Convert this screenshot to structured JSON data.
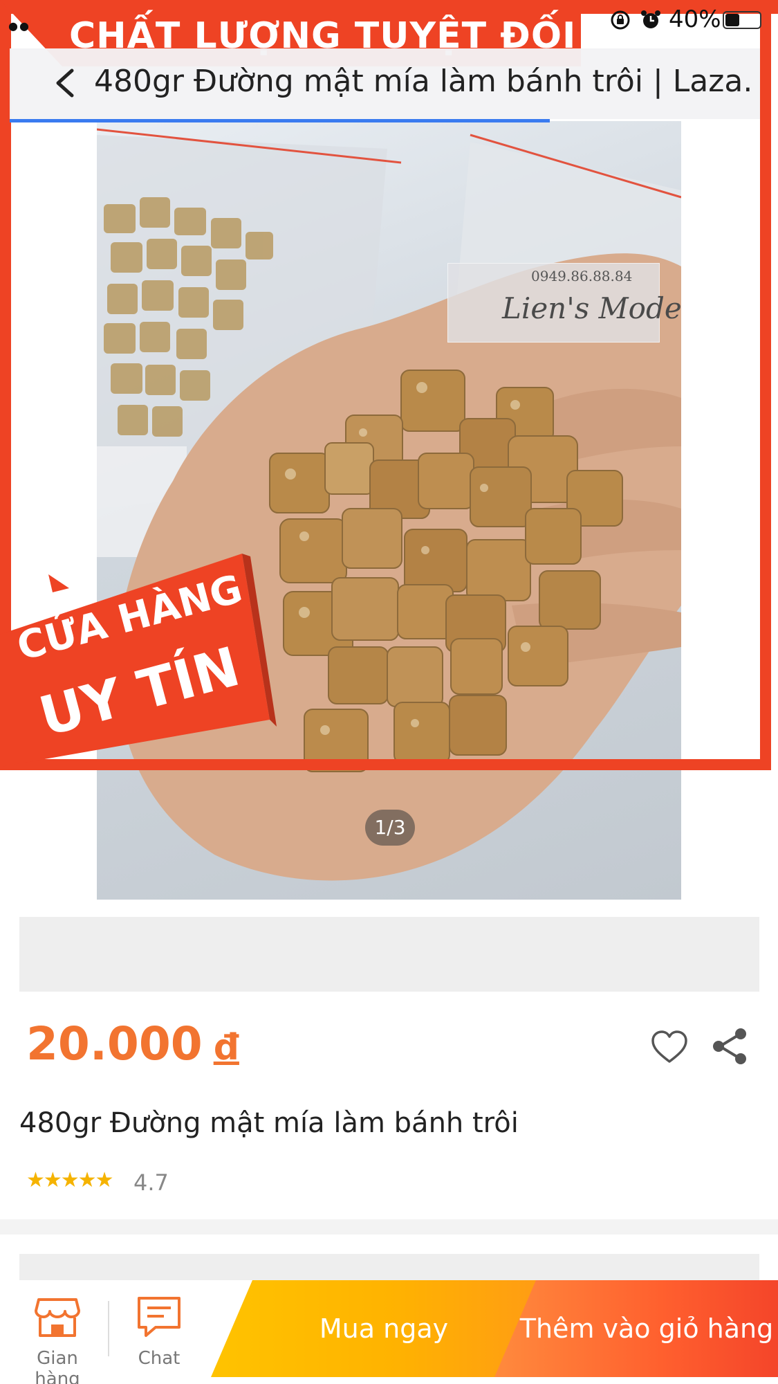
{
  "status_bar": {
    "battery_percent": "40%",
    "icons": [
      "rotation-lock-icon",
      "alarm-icon",
      "battery-icon"
    ]
  },
  "nav": {
    "back_icon": "chevron-left-icon",
    "title": "480gr Đường mật mía làm bánh trôi | Laza...",
    "load_progress": 0.72
  },
  "gallery": {
    "promo_banner": "CHẤT LƯỢNG TUYỆT ĐỐI",
    "badge_line1": "CỬA HÀNG",
    "badge_line2": "UY TÍN",
    "watermark_phone": "0949.86.88.84",
    "watermark_name": "Lien's Mode",
    "counter": "1/3"
  },
  "product": {
    "price": "20.000",
    "currency": "đ",
    "name": "480gr Đường mật mía làm bánh trôi",
    "stars": "★★★★★",
    "rating": "4.7",
    "rating_value": 4.7,
    "wishlist_icon": "heart-icon",
    "share_icon": "share-icon"
  },
  "bottom_bar": {
    "store_label": "Gian hàng",
    "chat_label": "Chat",
    "buy_now_label": "Mua ngay",
    "add_to_cart_label": "Thêm vào giỏ hàng"
  },
  "colors": {
    "accent": "#f27430",
    "promo_red": "#ee4324",
    "buy_now_yellow": "#ffc300",
    "add_to_cart_orange": "#ff5f2e",
    "star": "#f5b301",
    "progress_blue": "#3a7bf0"
  }
}
